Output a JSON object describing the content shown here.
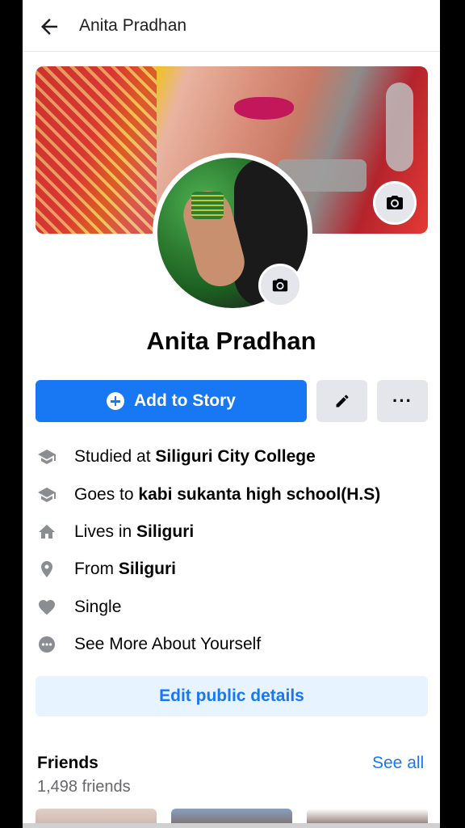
{
  "header": {
    "title": "Anita Pradhan"
  },
  "profile": {
    "name": "Anita Pradhan",
    "add_story_label": "Add to Story",
    "more_label": "···"
  },
  "details": [
    {
      "icon": "graduation-cap-icon",
      "prefix": "Studied at ",
      "bold": "Siliguri City College"
    },
    {
      "icon": "graduation-cap-icon",
      "prefix": "Goes to ",
      "bold": "kabi sukanta high school(H.S)"
    },
    {
      "icon": "home-icon",
      "prefix": "Lives in ",
      "bold": "Siliguri"
    },
    {
      "icon": "location-pin-icon",
      "prefix": "From ",
      "bold": "Siliguri"
    },
    {
      "icon": "heart-icon",
      "prefix": "Single",
      "bold": ""
    },
    {
      "icon": "ellipsis-circle-icon",
      "prefix": "See More About Yourself",
      "bold": ""
    }
  ],
  "edit_public_label": "Edit public details",
  "friends": {
    "title": "Friends",
    "see_all": "See all",
    "count": "1,498 friends"
  },
  "colors": {
    "primary": "#1877f2",
    "secondary_bg": "#e4e6eb",
    "light_blue": "#e7f3ff"
  }
}
